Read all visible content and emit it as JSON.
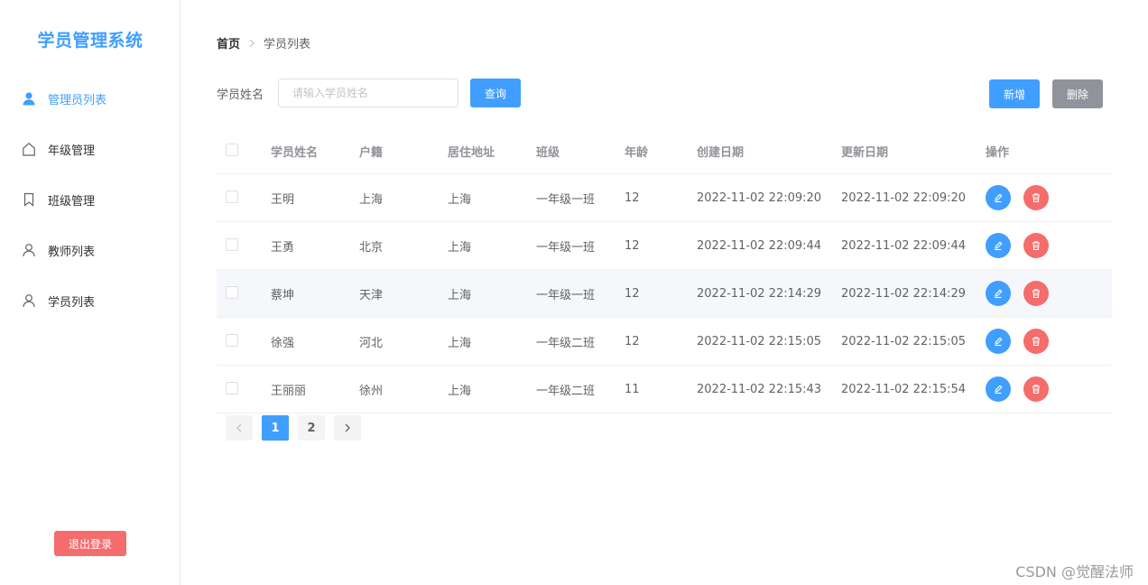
{
  "app_title": "学员管理系统",
  "sidebar": {
    "items": [
      {
        "label": "管理员列表",
        "icon": "user-filled-icon",
        "active": true
      },
      {
        "label": "年级管理",
        "icon": "home-icon"
      },
      {
        "label": "班级管理",
        "icon": "bookmark-icon"
      },
      {
        "label": "教师列表",
        "icon": "user-icon"
      },
      {
        "label": "学员列表",
        "icon": "user-icon"
      }
    ],
    "logout_label": "退出登录"
  },
  "breadcrumb": {
    "home": "首页",
    "current": "学员列表"
  },
  "search": {
    "label": "学员姓名",
    "placeholder": "请输入学员姓名",
    "value": "",
    "query_label": "查询"
  },
  "toolbar": {
    "add_label": "新增",
    "delete_label": "删除"
  },
  "table": {
    "columns": [
      "学员姓名",
      "户籍",
      "居住地址",
      "班级",
      "年龄",
      "创建日期",
      "更新日期",
      "操作"
    ],
    "rows": [
      {
        "name": "王明",
        "hometown": "上海",
        "address": "上海",
        "class": "一年级一班",
        "age": "12",
        "created": "2022-11-02 22:09:20",
        "updated": "2022-11-02 22:09:20"
      },
      {
        "name": "王勇",
        "hometown": "北京",
        "address": "上海",
        "class": "一年级一班",
        "age": "12",
        "created": "2022-11-02 22:09:44",
        "updated": "2022-11-02 22:09:44"
      },
      {
        "name": "蔡坤",
        "hometown": "天津",
        "address": "上海",
        "class": "一年级一班",
        "age": "12",
        "created": "2022-11-02 22:14:29",
        "updated": "2022-11-02 22:14:29"
      },
      {
        "name": "徐强",
        "hometown": "河北",
        "address": "上海",
        "class": "一年级二班",
        "age": "12",
        "created": "2022-11-02 22:15:05",
        "updated": "2022-11-02 22:15:05"
      },
      {
        "name": "王丽丽",
        "hometown": "徐州",
        "address": "上海",
        "class": "一年级二班",
        "age": "11",
        "created": "2022-11-02 22:15:43",
        "updated": "2022-11-02 22:15:54"
      }
    ]
  },
  "pagination": {
    "pages": [
      "1",
      "2"
    ],
    "current": "1"
  },
  "watermark": "CSDN @觉醒法师",
  "colors": {
    "primary": "#409eff",
    "danger": "#f56c6c",
    "info": "#909399"
  }
}
